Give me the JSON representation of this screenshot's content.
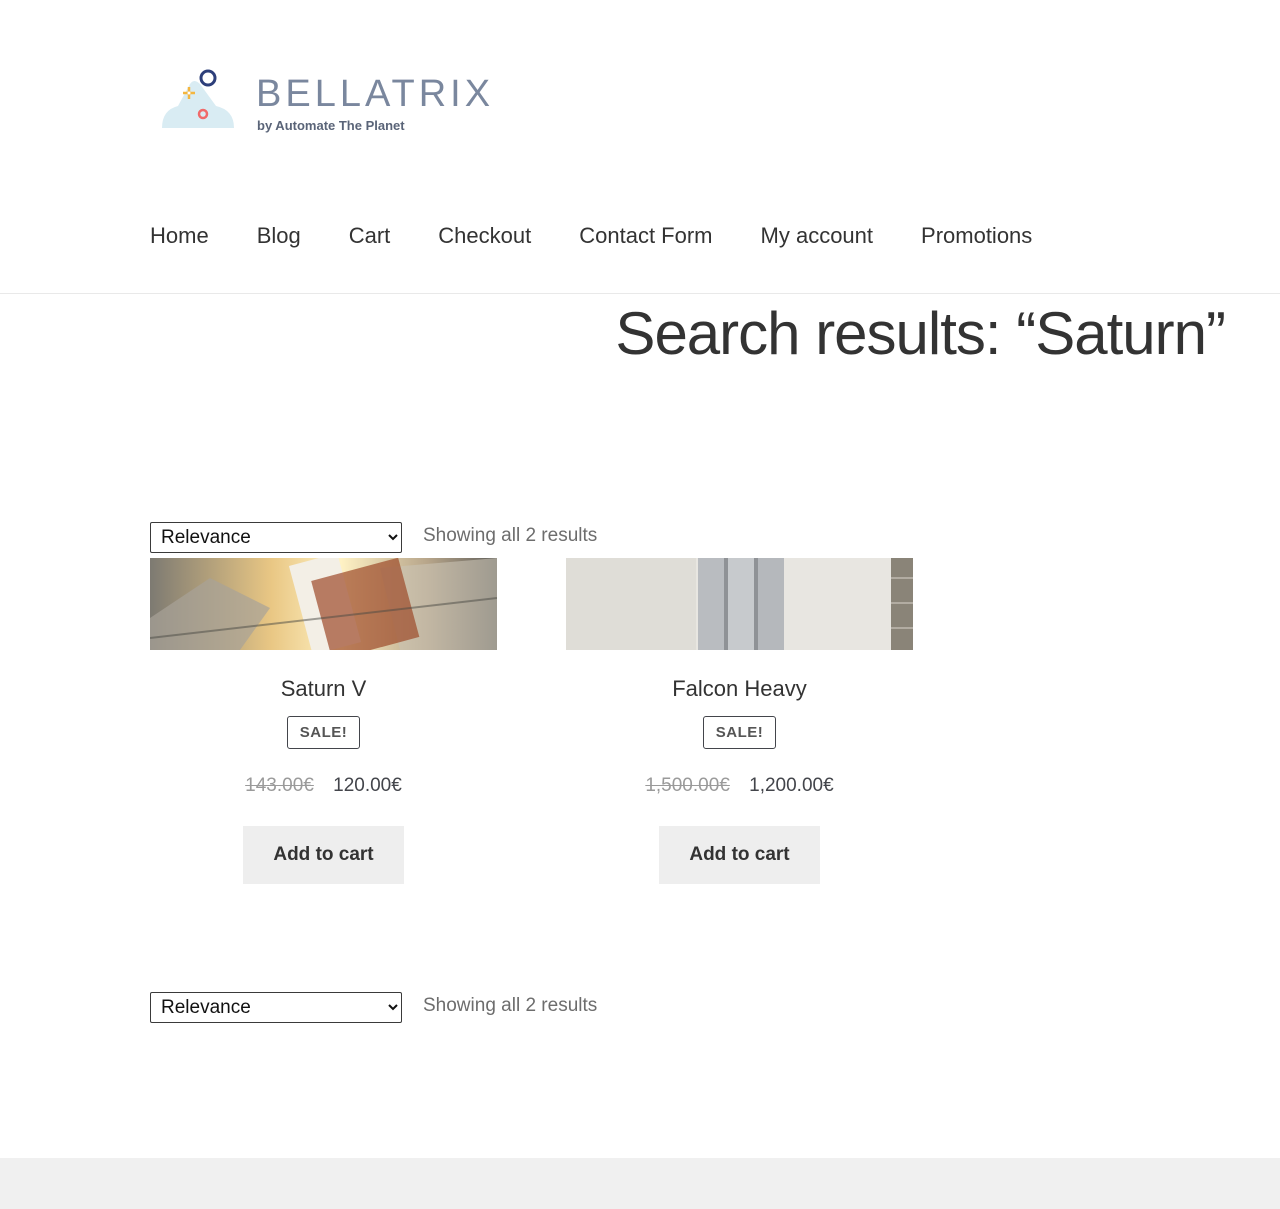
{
  "brand": {
    "name": "BELLATRIX",
    "tagline": "by Automate The Planet"
  },
  "nav": [
    "Home",
    "Blog",
    "Cart",
    "Checkout",
    "Contact Form",
    "My account",
    "Promotions"
  ],
  "page_title": "Search results: “Saturn”",
  "sorting": {
    "selected": "Relevance",
    "results_count": "Showing all 2 results"
  },
  "products": [
    {
      "name": "Saturn V",
      "badge": "SALE!",
      "old_price": "143.00€",
      "price": "120.00€",
      "button": "Add to cart"
    },
    {
      "name": "Falcon Heavy",
      "badge": "SALE!",
      "old_price": "1,500.00€",
      "price": "1,200.00€",
      "button": "Add to cart"
    }
  ]
}
